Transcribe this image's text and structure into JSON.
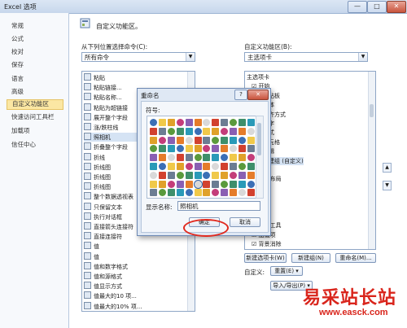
{
  "window": {
    "title": "Excel 选项",
    "min_label": "—",
    "max_label": "□",
    "close_label": "✕"
  },
  "nav": [
    "常规",
    "公式",
    "校对",
    "保存",
    "语言",
    "高级",
    "自定义功能区",
    "快速访问工具栏",
    "加载项",
    "信任中心"
  ],
  "nav_active_index": 6,
  "header": {
    "text": "自定义功能区。"
  },
  "left_panel": {
    "label": "从下列位置选择命令(C):",
    "combo_value": "所有命令",
    "items": [
      "粘贴",
      "粘贴链接...",
      "粘贴名称...",
      "粘贴为超链接",
      "展开整个字段",
      "涨/跌柱线",
      "照相机",
      "折叠整个字段",
      "折线",
      "折线图",
      "折线图",
      "折线图",
      "整个数据透视表",
      "只保留文本",
      "执行对话框",
      "直接箭头连接符",
      "直接连接符",
      "值",
      "值",
      "值和数字格式",
      "值和源格式",
      "值显示方式",
      "值最大的10 项...",
      "值最大的10% 项..."
    ],
    "selected_index": 6
  },
  "right_panel": {
    "label": "自定义功能区(B):",
    "combo_value": "主选项卡",
    "items": [
      "主选项卡",
      "☑ 开始",
      "剪贴板",
      "字体",
      "对齐方式",
      "数字",
      "样式",
      "单元格",
      "编辑",
      "新建组 (自定义)",
      "☑ 插入",
      "☑ 页面布局",
      "☑ 公式",
      "☑ 数据",
      "☑ 审阅",
      "☑ 视图",
      "☑ 开发工具",
      "☑ 加载项",
      "☑ 背景消除"
    ],
    "selected_index": 9
  },
  "buttons": {
    "new_tab": "新建选项卡(W)",
    "new_group": "新建组(N)",
    "rename": "重命名(M)...",
    "customize_label": "自定义:",
    "reset": "重置(E) ▾",
    "import_export": "导入/导出(P) ▾"
  },
  "dialog": {
    "title": "重命名",
    "help": "?",
    "close": "✕",
    "symbol_label": "符号:",
    "display_name_label": "显示名称:",
    "display_name_value": "照相机",
    "ok": "确定",
    "cancel": "取消"
  },
  "watermark": {
    "cn": "易采站长站",
    "url": "www.easck.com"
  },
  "colors": {
    "accent_ring": "#e12a1f",
    "watermark": "#d9251c",
    "nav_active": "#fbe7a3"
  }
}
